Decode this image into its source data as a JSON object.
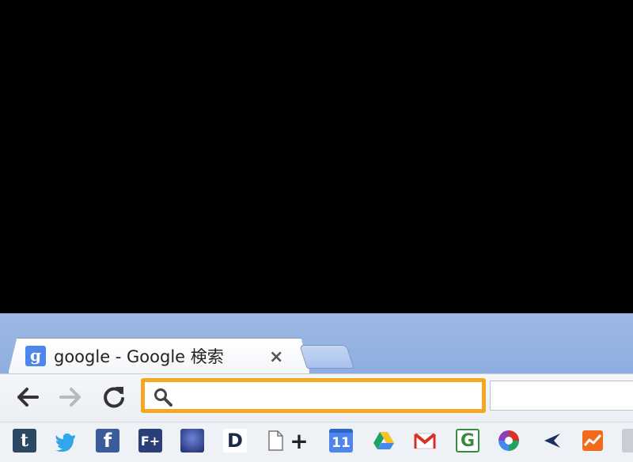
{
  "tab": {
    "title": "google - Google 検索",
    "favicon_letter": "g",
    "close_symbol": "×"
  },
  "omnibox": {
    "value": "",
    "placeholder": ""
  },
  "bookmarks": [
    {
      "name": "tumblr-icon",
      "glyph": "t"
    },
    {
      "name": "twitter-icon",
      "glyph": ""
    },
    {
      "name": "facebook-icon",
      "glyph": "f"
    },
    {
      "name": "feedly-plus-icon",
      "glyph": "F+"
    },
    {
      "name": "starry-night-icon",
      "glyph": ""
    },
    {
      "name": "d-icon",
      "glyph": "D"
    },
    {
      "name": "blank-page-icon",
      "glyph": ""
    },
    {
      "name": "plus-icon",
      "glyph": "+"
    },
    {
      "name": "calendar-icon",
      "glyph": "11"
    },
    {
      "name": "google-drive-icon",
      "glyph": ""
    },
    {
      "name": "gmail-icon",
      "glyph": ""
    },
    {
      "name": "google-g-icon",
      "glyph": "G"
    },
    {
      "name": "picasa-icon",
      "glyph": ""
    },
    {
      "name": "arrow-bird-icon",
      "glyph": ""
    },
    {
      "name": "analytics-icon",
      "glyph": ""
    }
  ],
  "colors": {
    "highlight": "#f5a623",
    "frame": "#8faee0"
  }
}
